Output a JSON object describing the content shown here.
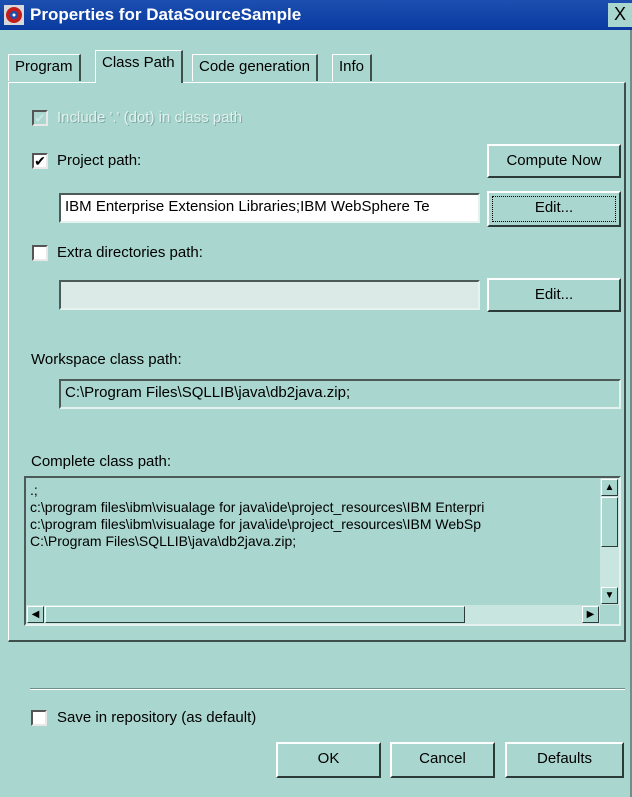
{
  "window": {
    "title": "Properties for DataSourceSample",
    "close_label": "X"
  },
  "tabs": [
    {
      "label": "Program"
    },
    {
      "label": "Class Path"
    },
    {
      "label": "Code generation"
    },
    {
      "label": "Info"
    }
  ],
  "class_path": {
    "include_dot_label": "Include '.' (dot) in class path",
    "include_dot_checked": true,
    "project_path_label": "Project path:",
    "project_path_checked": true,
    "project_path_value": "IBM Enterprise Extension Libraries;IBM WebSphere Te",
    "compute_now_label": "Compute Now",
    "edit_label": "Edit...",
    "extra_dirs_label": "Extra directories path:",
    "extra_dirs_checked": false,
    "extra_dirs_value": "",
    "edit2_label": "Edit...",
    "workspace_label": "Workspace class path:",
    "workspace_value": "C:\\Program Files\\SQLLIB\\java\\db2java.zip;",
    "complete_label": "Complete class path:",
    "complete_lines": [
      ".;",
      "c:\\program files\\ibm\\visualage for java\\ide\\project_resources\\IBM Enterpri",
      "c:\\program files\\ibm\\visualage for java\\ide\\project_resources\\IBM WebSp",
      "C:\\Program Files\\SQLLIB\\java\\db2java.zip;"
    ]
  },
  "footer": {
    "save_repo_label": "Save in repository (as default)",
    "save_repo_checked": false,
    "ok_label": "OK",
    "cancel_label": "Cancel",
    "defaults_label": "Defaults"
  },
  "icons": {
    "app": "visualage-app-icon",
    "check": "✔",
    "arrow_up": "▲",
    "arrow_down": "▼",
    "arrow_left": "◀",
    "arrow_right": "▶"
  },
  "colors": {
    "face": "#a9d6cf",
    "title_bar": "#0a3aa0"
  }
}
